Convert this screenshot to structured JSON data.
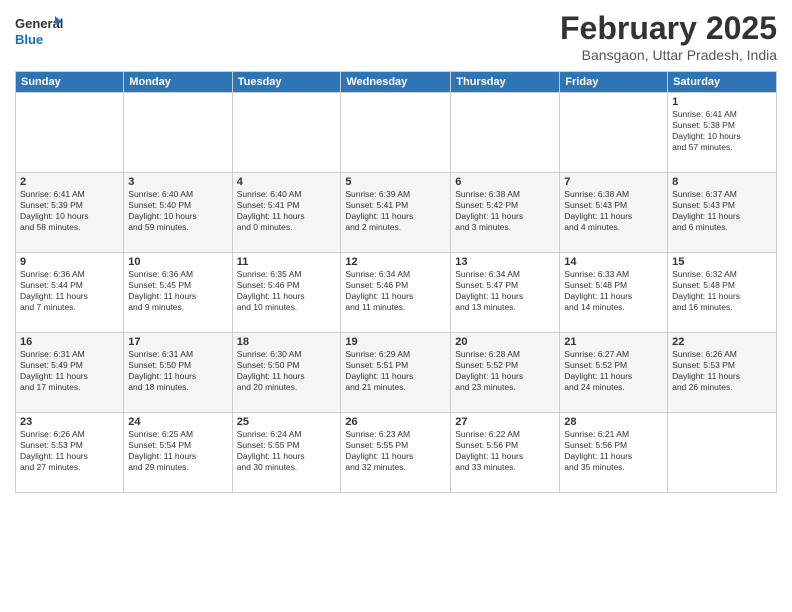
{
  "header": {
    "logo": {
      "line1": "General",
      "line2": "Blue"
    },
    "title": "February 2025",
    "location": "Bansgaon, Uttar Pradesh, India"
  },
  "calendar": {
    "days_of_week": [
      "Sunday",
      "Monday",
      "Tuesday",
      "Wednesday",
      "Thursday",
      "Friday",
      "Saturday"
    ],
    "weeks": [
      [
        {
          "day": "",
          "info": ""
        },
        {
          "day": "",
          "info": ""
        },
        {
          "day": "",
          "info": ""
        },
        {
          "day": "",
          "info": ""
        },
        {
          "day": "",
          "info": ""
        },
        {
          "day": "",
          "info": ""
        },
        {
          "day": "1",
          "info": "Sunrise: 6:41 AM\nSunset: 5:38 PM\nDaylight: 10 hours\nand 57 minutes."
        }
      ],
      [
        {
          "day": "2",
          "info": "Sunrise: 6:41 AM\nSunset: 5:39 PM\nDaylight: 10 hours\nand 58 minutes."
        },
        {
          "day": "3",
          "info": "Sunrise: 6:40 AM\nSunset: 5:40 PM\nDaylight: 10 hours\nand 59 minutes."
        },
        {
          "day": "4",
          "info": "Sunrise: 6:40 AM\nSunset: 5:41 PM\nDaylight: 11 hours\nand 0 minutes."
        },
        {
          "day": "5",
          "info": "Sunrise: 6:39 AM\nSunset: 5:41 PM\nDaylight: 11 hours\nand 2 minutes."
        },
        {
          "day": "6",
          "info": "Sunrise: 6:38 AM\nSunset: 5:42 PM\nDaylight: 11 hours\nand 3 minutes."
        },
        {
          "day": "7",
          "info": "Sunrise: 6:38 AM\nSunset: 5:43 PM\nDaylight: 11 hours\nand 4 minutes."
        },
        {
          "day": "8",
          "info": "Sunrise: 6:37 AM\nSunset: 5:43 PM\nDaylight: 11 hours\nand 6 minutes."
        }
      ],
      [
        {
          "day": "9",
          "info": "Sunrise: 6:36 AM\nSunset: 5:44 PM\nDaylight: 11 hours\nand 7 minutes."
        },
        {
          "day": "10",
          "info": "Sunrise: 6:36 AM\nSunset: 5:45 PM\nDaylight: 11 hours\nand 9 minutes."
        },
        {
          "day": "11",
          "info": "Sunrise: 6:35 AM\nSunset: 5:46 PM\nDaylight: 11 hours\nand 10 minutes."
        },
        {
          "day": "12",
          "info": "Sunrise: 6:34 AM\nSunset: 5:46 PM\nDaylight: 11 hours\nand 11 minutes."
        },
        {
          "day": "13",
          "info": "Sunrise: 6:34 AM\nSunset: 5:47 PM\nDaylight: 11 hours\nand 13 minutes."
        },
        {
          "day": "14",
          "info": "Sunrise: 6:33 AM\nSunset: 5:48 PM\nDaylight: 11 hours\nand 14 minutes."
        },
        {
          "day": "15",
          "info": "Sunrise: 6:32 AM\nSunset: 5:48 PM\nDaylight: 11 hours\nand 16 minutes."
        }
      ],
      [
        {
          "day": "16",
          "info": "Sunrise: 6:31 AM\nSunset: 5:49 PM\nDaylight: 11 hours\nand 17 minutes."
        },
        {
          "day": "17",
          "info": "Sunrise: 6:31 AM\nSunset: 5:50 PM\nDaylight: 11 hours\nand 18 minutes."
        },
        {
          "day": "18",
          "info": "Sunrise: 6:30 AM\nSunset: 5:50 PM\nDaylight: 11 hours\nand 20 minutes."
        },
        {
          "day": "19",
          "info": "Sunrise: 6:29 AM\nSunset: 5:51 PM\nDaylight: 11 hours\nand 21 minutes."
        },
        {
          "day": "20",
          "info": "Sunrise: 6:28 AM\nSunset: 5:52 PM\nDaylight: 11 hours\nand 23 minutes."
        },
        {
          "day": "21",
          "info": "Sunrise: 6:27 AM\nSunset: 5:52 PM\nDaylight: 11 hours\nand 24 minutes."
        },
        {
          "day": "22",
          "info": "Sunrise: 6:26 AM\nSunset: 5:53 PM\nDaylight: 11 hours\nand 26 minutes."
        }
      ],
      [
        {
          "day": "23",
          "info": "Sunrise: 6:26 AM\nSunset: 5:53 PM\nDaylight: 11 hours\nand 27 minutes."
        },
        {
          "day": "24",
          "info": "Sunrise: 6:25 AM\nSunset: 5:54 PM\nDaylight: 11 hours\nand 29 minutes."
        },
        {
          "day": "25",
          "info": "Sunrise: 6:24 AM\nSunset: 5:55 PM\nDaylight: 11 hours\nand 30 minutes."
        },
        {
          "day": "26",
          "info": "Sunrise: 6:23 AM\nSunset: 5:55 PM\nDaylight: 11 hours\nand 32 minutes."
        },
        {
          "day": "27",
          "info": "Sunrise: 6:22 AM\nSunset: 5:56 PM\nDaylight: 11 hours\nand 33 minutes."
        },
        {
          "day": "28",
          "info": "Sunrise: 6:21 AM\nSunset: 5:56 PM\nDaylight: 11 hours\nand 35 minutes."
        },
        {
          "day": "",
          "info": ""
        }
      ]
    ]
  }
}
